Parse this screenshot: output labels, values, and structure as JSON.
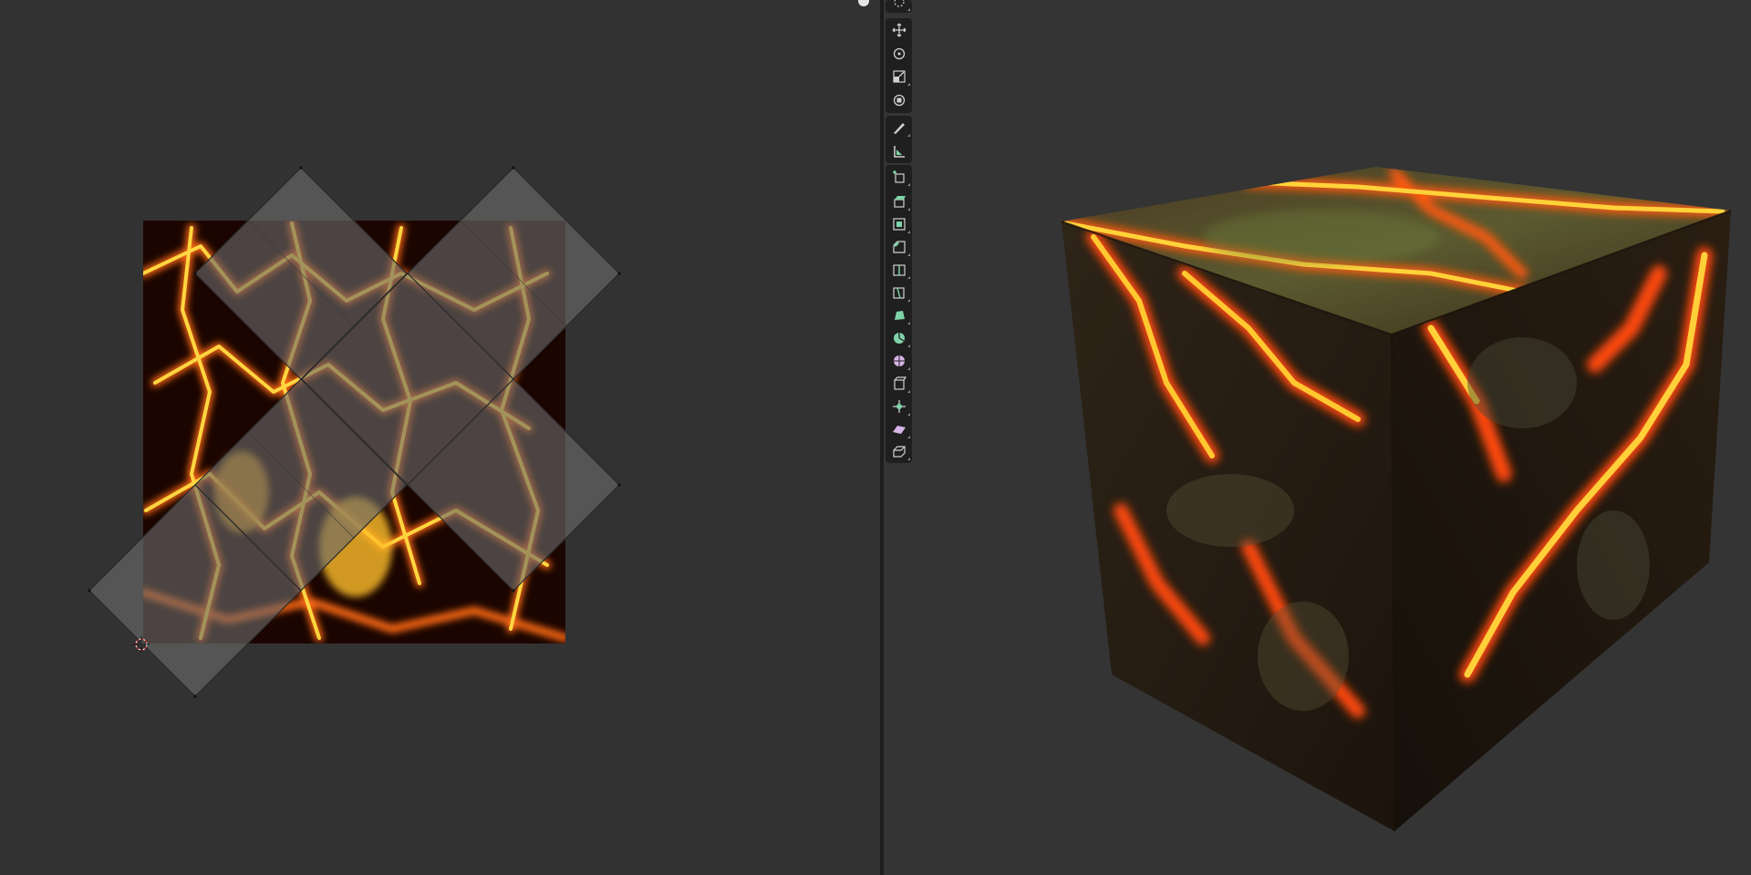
{
  "app": {
    "editors": {
      "left": "uv-editor",
      "right": "3d-viewport"
    }
  },
  "uv_editor": {
    "texture": "lava",
    "uv_islands": 5,
    "background_color": "#323232",
    "island_fill": "#6a6a6a",
    "edge_color": "#2a2a2a"
  },
  "viewport": {
    "object": "cube",
    "material": "lava-rock",
    "background_color": "#343434"
  },
  "toolbar": {
    "tools": [
      {
        "icon": "cursor-icon"
      },
      {
        "icon": "move-icon"
      },
      {
        "icon": "rotate-icon"
      },
      {
        "icon": "scale-icon"
      },
      {
        "icon": "transform-icon"
      },
      {
        "icon": "annotate-icon"
      },
      {
        "icon": "measure-icon"
      },
      {
        "icon": "add-cube-icon"
      },
      {
        "icon": "extrude-region-icon"
      },
      {
        "icon": "inset-faces-icon"
      },
      {
        "icon": "bevel-icon"
      },
      {
        "icon": "loop-cut-icon"
      },
      {
        "icon": "knife-icon"
      },
      {
        "icon": "poly-build-icon"
      },
      {
        "icon": "spin-icon"
      },
      {
        "icon": "smooth-icon"
      },
      {
        "icon": "edge-slide-icon"
      },
      {
        "icon": "shrink-fatten-icon"
      },
      {
        "icon": "shear-icon"
      },
      {
        "icon": "rip-region-icon"
      }
    ],
    "colors": {
      "mesh_tool_green": "#7fd3a7",
      "icon_light": "#d0d0d0",
      "shear_pink": "#d8b4e8"
    }
  }
}
